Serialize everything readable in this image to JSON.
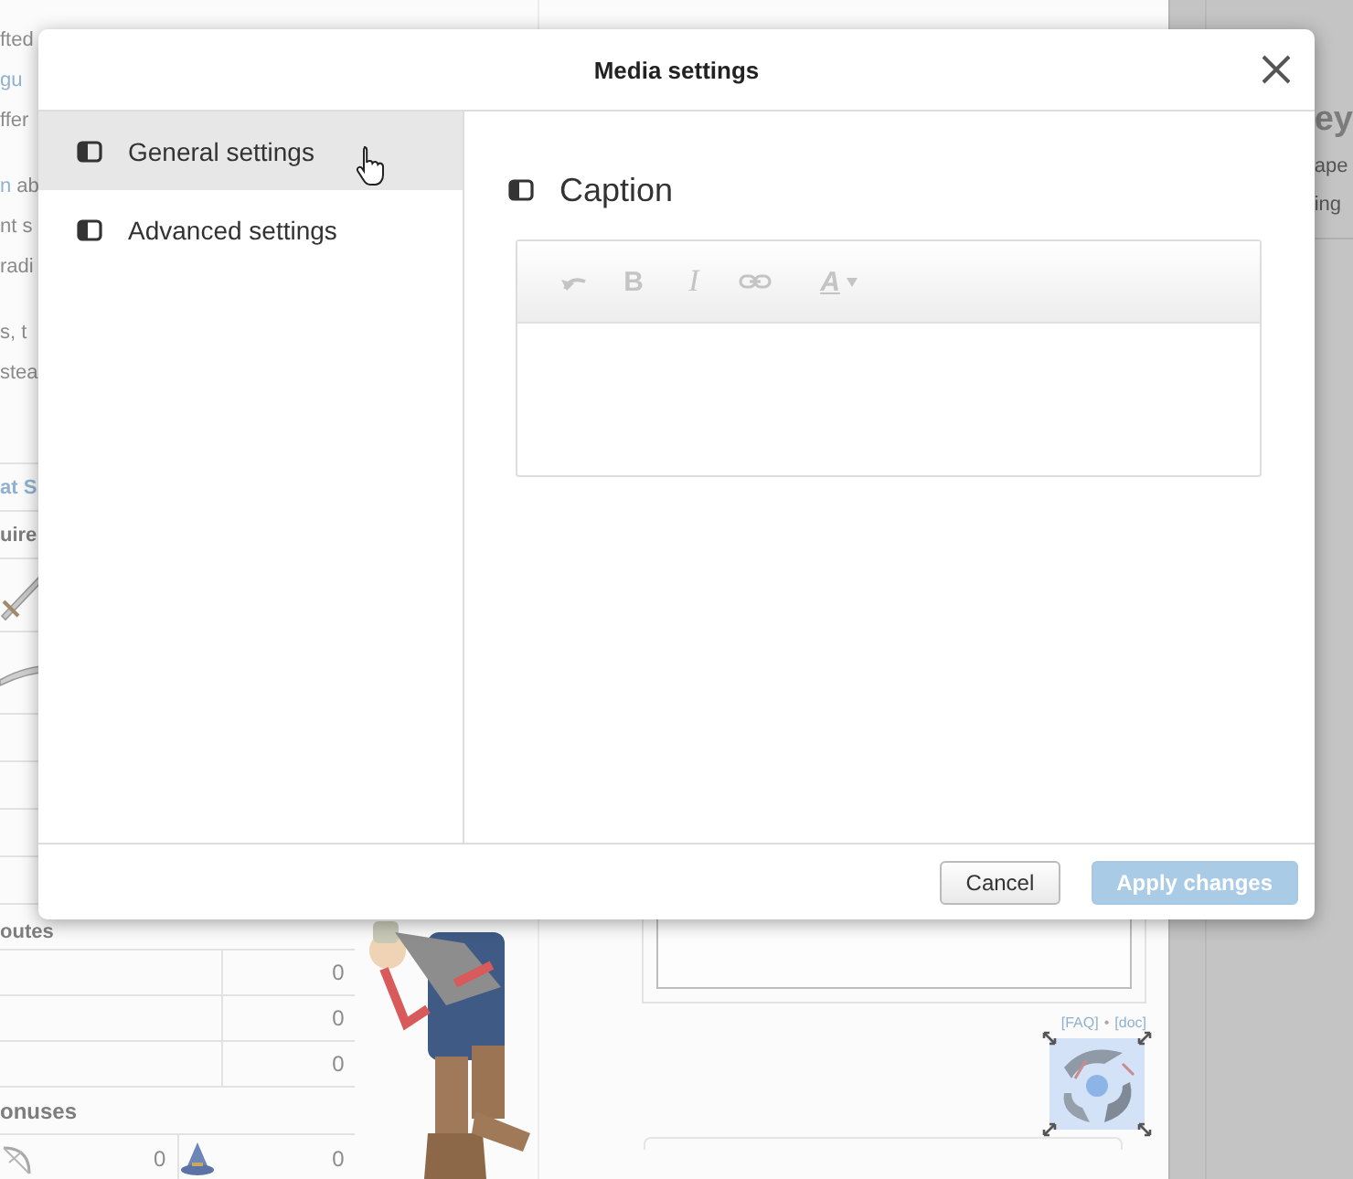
{
  "background": {
    "paragraphs": [
      [
        [
          {
            "text": "fted",
            "link": false
          }
        ],
        [
          {
            "text": "gu",
            "link": true
          }
        ],
        [
          {
            "text": "ffer",
            "link": false
          }
        ]
      ],
      [
        [
          {
            "text": "n",
            "link": true
          },
          {
            "text": " ab",
            "link": false
          }
        ],
        [
          {
            "text": "nt s",
            "link": false
          }
        ],
        [
          {
            "text": "radi",
            "link": false
          }
        ]
      ],
      [
        [
          {
            "text": "s, t",
            "link": false
          }
        ],
        [
          {
            "text": "stea",
            "link": false
          }
        ]
      ]
    ],
    "infobox": {
      "title": "at S",
      "requirements_heading": "uire",
      "attributes_heading": "outes",
      "attributes": [
        "0",
        "0",
        "0"
      ],
      "bonuses_heading": "onuses",
      "bonuses": [
        "0",
        "0"
      ]
    },
    "file_links": {
      "links": [
        "[FAQ]",
        "[doc]"
      ],
      "separator": "•"
    },
    "sidebar": {
      "heading": "ey",
      "lines": [
        "ape",
        "ing"
      ]
    }
  },
  "dialog": {
    "title": "Media settings",
    "nav": [
      {
        "label": "General settings",
        "selected": true
      },
      {
        "label": "Advanced settings",
        "selected": false
      }
    ],
    "section_title": "Caption",
    "toolbar": [
      {
        "kind": "undo",
        "disabled": true
      },
      {
        "kind": "bold",
        "label": "B",
        "disabled": true
      },
      {
        "kind": "italic",
        "label": "I",
        "disabled": true
      },
      {
        "kind": "link",
        "disabled": true
      },
      {
        "kind": "color",
        "label": "A",
        "disabled": true
      }
    ],
    "buttons": [
      {
        "label": "Cancel",
        "kind": "secondary",
        "disabled": false
      },
      {
        "label": "Apply changes",
        "kind": "primary",
        "disabled": true
      }
    ]
  }
}
